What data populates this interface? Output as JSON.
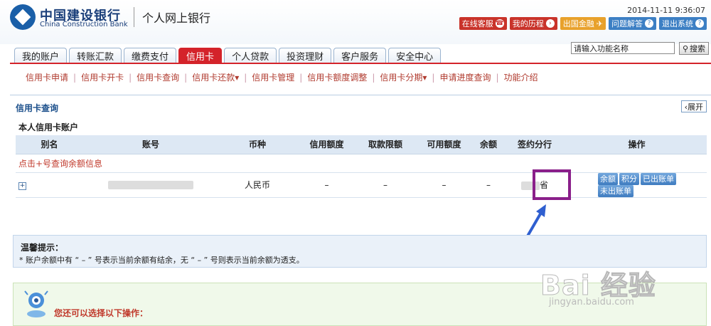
{
  "brand": {
    "name_cn": "中国建设银行",
    "name_en": "China Construction Bank",
    "subtitle": "个人网上银行",
    "logo_icon": "ccb-logo-icon"
  },
  "header": {
    "datetime": "2014-11-11 9:36:07",
    "buttons": [
      {
        "label": "在线客服",
        "icon": "headset-icon",
        "color": "#c9332a"
      },
      {
        "label": "我的历程",
        "icon": "chevron-icon",
        "color": "#c9332a"
      },
      {
        "label": "出国金融",
        "icon": "plane-icon",
        "color": "#e8a12b"
      },
      {
        "label": "问题解答",
        "icon": "help-icon",
        "color": "#3c7fc4"
      },
      {
        "label": "退出系统",
        "icon": "help-icon",
        "color": "#3c7fc4"
      }
    ]
  },
  "search": {
    "value": "请输入功能名称",
    "button_label": "搜索"
  },
  "tabs": [
    {
      "label": "我的账户",
      "active": false
    },
    {
      "label": "转账汇款",
      "active": false
    },
    {
      "label": "缴费支付",
      "active": false
    },
    {
      "label": "信用卡",
      "active": true
    },
    {
      "label": "个人贷款",
      "active": false
    },
    {
      "label": "投资理财",
      "active": false
    },
    {
      "label": "客户服务",
      "active": false
    },
    {
      "label": "安全中心",
      "active": false
    }
  ],
  "subnav": [
    "信用卡申请",
    "信用卡开卡",
    "信用卡查询",
    "信用卡还款▾",
    "信用卡管理",
    "信用卡额度调整",
    "信用卡分期▾",
    "申请进度查询",
    "功能介绍"
  ],
  "page": {
    "title": "信用卡查询",
    "expand_label": "‹展开",
    "table_caption": "本人信用卡账户"
  },
  "table": {
    "headers": [
      "别名",
      "账号",
      "币种",
      "信用额度",
      "取款限额",
      "可用额度",
      "余额",
      "签约分行",
      "操作"
    ],
    "hint": "点击+号查询余额信息",
    "row": {
      "expand": "+",
      "currency": "人民币",
      "credit_limit": "–",
      "withdraw_limit": "–",
      "available": "–",
      "balance": "–",
      "branch_suffix": "省"
    },
    "actions": [
      "余额",
      "积分",
      "已出账单",
      "未出账单"
    ]
  },
  "tips": {
    "title": "温馨提示：",
    "text": "* 账户余额中有 “ – ” 号表示当前余额有结余，无 “ – ” 号则表示当前余额为透支。"
  },
  "ops": {
    "title": "您还可以选择以下操作："
  },
  "watermark": {
    "main": "Bai 经验",
    "url": "jingyan.baidu.com"
  },
  "colors": {
    "accent_red": "#d4232a",
    "link_red": "#b03a2e",
    "title_blue": "#1b4f8b",
    "highlight_purple": "#8a1f8a",
    "arrow_blue": "#2f5fd0"
  }
}
